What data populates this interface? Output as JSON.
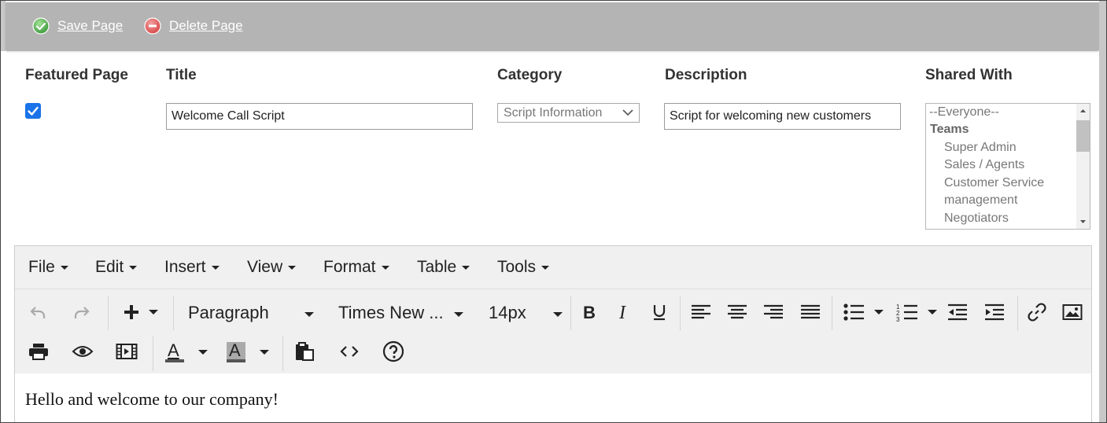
{
  "topbar": {
    "save_label": "Save Page",
    "delete_label": "Delete Page",
    "bg_color": "#b4b4b4"
  },
  "form": {
    "featured_label": "Featured Page",
    "featured_checked": true,
    "title_label": "Title",
    "title_value": "Welcome Call Script",
    "category_label": "Category",
    "category_value": "Script Information",
    "description_label": "Description",
    "description_value": "Script for welcoming new customers",
    "shared_label": "Shared With",
    "shared_options": [
      {
        "label": "--Everyone--",
        "type": "option"
      },
      {
        "label": "Teams",
        "type": "group"
      },
      {
        "label": "Super Admin",
        "type": "option"
      },
      {
        "label": "Sales / Agents",
        "type": "option"
      },
      {
        "label": "Customer Service",
        "type": "option"
      },
      {
        "label": "management",
        "type": "option"
      },
      {
        "label": "Negotiators",
        "type": "option"
      }
    ]
  },
  "editor": {
    "menus": [
      "File",
      "Edit",
      "Insert",
      "View",
      "Format",
      "Table",
      "Tools"
    ],
    "block_format": "Paragraph",
    "font_family": "Times New ...",
    "font_size": "14px",
    "toolbar_icons": [
      "undo-icon",
      "redo-icon",
      "insert-plus-icon",
      "bold-icon",
      "italic-icon",
      "underline-icon",
      "align-left-icon",
      "align-center-icon",
      "align-right-icon",
      "align-justify-icon",
      "bullet-list-icon",
      "numbered-list-icon",
      "outdent-icon",
      "indent-icon",
      "link-icon",
      "image-icon",
      "print-icon",
      "preview-icon",
      "media-icon",
      "text-color-icon",
      "background-color-icon",
      "paste-icon",
      "source-code-icon",
      "help-icon"
    ],
    "text_color_swatch": "#555555",
    "bg_color_swatch": "#aaaaaa",
    "content_text": "Hello and welcome to our company!"
  },
  "colors": {
    "checkbox": "#1a73e8",
    "save_icon": "#5cb85c",
    "delete_icon": "#e05a5a"
  }
}
